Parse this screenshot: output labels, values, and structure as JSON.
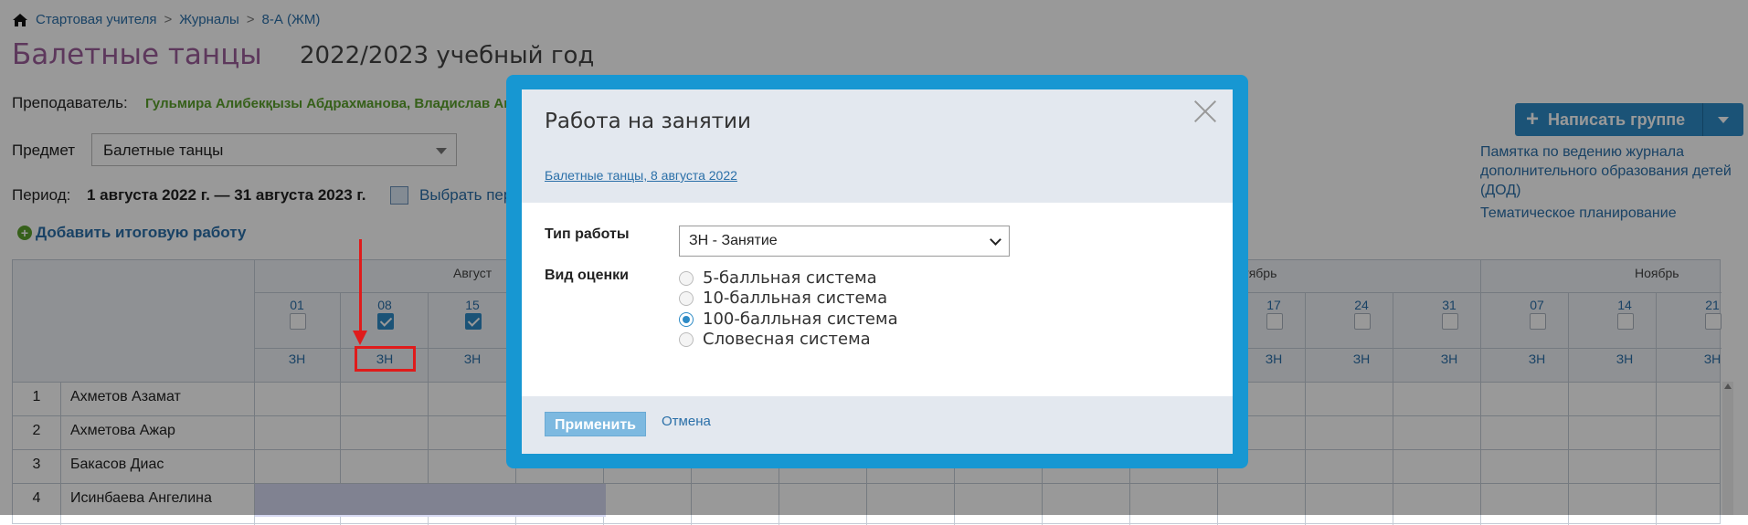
{
  "breadcrumb": {
    "items": [
      "Стартовая учителя",
      "Журналы",
      "8-А (ЖМ)"
    ],
    "separator": ">"
  },
  "page": {
    "title": "Балетные танцы",
    "year": "2022/2023 учебный год"
  },
  "teacher": {
    "label": "Преподаватель:",
    "value": "Гульмира Алибекқызы Абдрахманова, Владислав Ан"
  },
  "subject": {
    "label": "Предмет",
    "value": "Балетные танцы"
  },
  "period": {
    "label": "Период:",
    "value": "1 августа 2022 г. — 31 августа 2023 г.",
    "choose": "Выбрать пер"
  },
  "add_final": "Добавить итоговую работу",
  "write_group": "Написать группе",
  "memo": "Памятка по ведению журнала дополнительного образования детей (ДОД)",
  "thematic": "Тематическое планирование",
  "grid": {
    "months": [
      "Август",
      "ктябрь",
      "Ноябрь"
    ],
    "days_left": [
      "01",
      "08",
      "15"
    ],
    "days_right": [
      "17",
      "24",
      "31",
      "07",
      "14",
      "21"
    ],
    "checked_left": [
      false,
      true,
      true
    ],
    "type_label": "ЗН",
    "students": [
      {
        "n": "1",
        "name": "Ахметов Азамат"
      },
      {
        "n": "2",
        "name": "Ахметова Ажар"
      },
      {
        "n": "3",
        "name": "Бакасов Диас"
      },
      {
        "n": "4",
        "name": "Исинбаева Ангелина"
      }
    ]
  },
  "modal": {
    "title": "Работа на занятии",
    "link": "Балетные танцы, 8 августа 2022",
    "work_type_label": "Тип работы",
    "work_type_value": "ЗН - Занятие",
    "grade_label": "Вид оценки",
    "grade_options": [
      "5-балльная система",
      "10-балльная система",
      "100-балльная система",
      "Словесная система"
    ],
    "grade_selected": "100-балльная система",
    "apply": "Применить",
    "cancel": "Отмена"
  },
  "colors": {
    "accent": "#2e8bc6",
    "modal_border": "#1797d2",
    "title": "#9b5e9a",
    "teacher": "#5aa02c",
    "annotation": "#e01b1b"
  }
}
